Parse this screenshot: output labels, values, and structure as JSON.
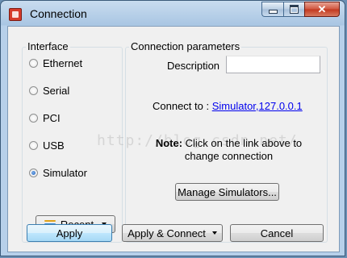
{
  "window": {
    "title": "Connection"
  },
  "interface_group": {
    "legend": "Interface",
    "options": [
      {
        "label": "Ethernet",
        "checked": false
      },
      {
        "label": "Serial",
        "checked": false
      },
      {
        "label": "PCI",
        "checked": false
      },
      {
        "label": "USB",
        "checked": false
      },
      {
        "label": "Simulator",
        "checked": true
      }
    ],
    "recent_label": "Recent"
  },
  "params_group": {
    "legend": "Connection parameters",
    "description_label": "Description",
    "description_value": "",
    "connect_to_label": "Connect to : ",
    "connect_to_link": "Simulator,127.0.0.1",
    "note_bold": "Note:",
    "note_text": " Click on the link above to change connection",
    "manage_label": "Manage Simulators..."
  },
  "footer": {
    "apply_label": "Apply",
    "apply_connect_label": "Apply & Connect",
    "cancel_label": "Cancel"
  },
  "watermark": "http://blog.csdn.net/",
  "colors": {
    "link": "#0000ee",
    "default_button_border": "#3c7fb1",
    "close_button": "#c2371e"
  }
}
